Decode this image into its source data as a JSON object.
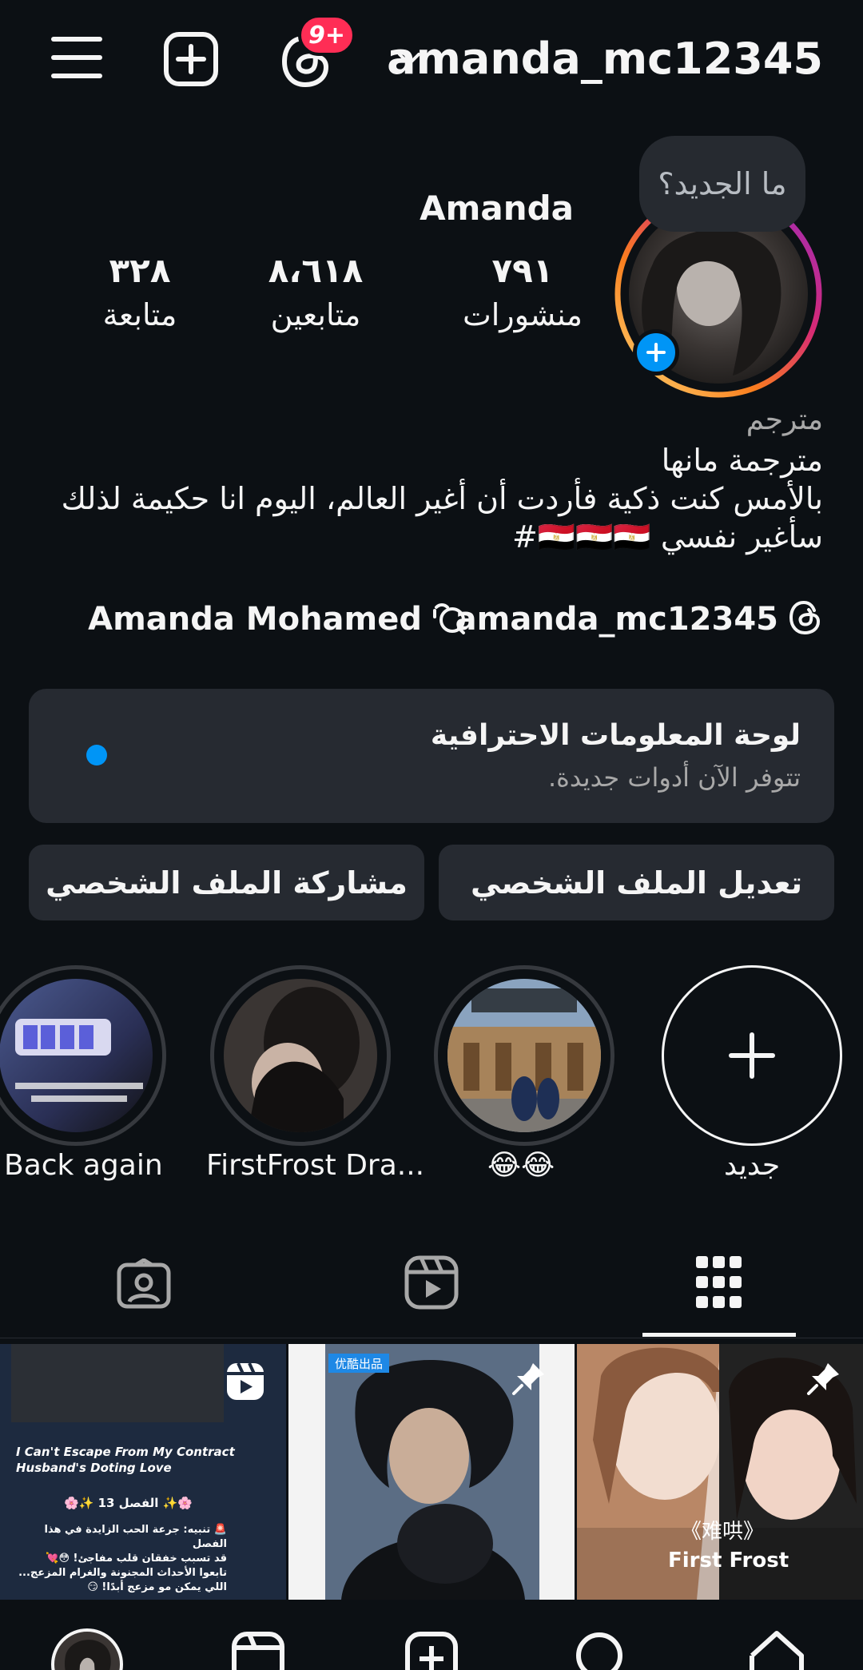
{
  "header": {
    "username": "amanda_mc12345",
    "notifications_badge": "9+",
    "icons": [
      "menu-icon",
      "add-post-icon",
      "threads-icon",
      "chevron-down-icon"
    ]
  },
  "profile": {
    "note_bubble": "ما الجديد؟",
    "display_name": "Amanda",
    "stats": [
      {
        "value": "٧٩١",
        "label": "منشورات"
      },
      {
        "value": "٨،٦١٨",
        "label": "متابعين"
      },
      {
        "value": "٣٢٨",
        "label": "متابعة"
      }
    ],
    "category": "مترجم",
    "bio_lines": [
      "مترجمة مانها",
      "بالأمس كنت ذكية فأردت أن أغير العالم، اليوم انا حكيمة لذلك",
      "سأغير نفسي 🇪🇬🇪🇬🇪🇬#"
    ],
    "threads_link": "amanda_mc12345",
    "linked_name": "Amanda Mohamed"
  },
  "dashboard": {
    "title": "لوحة المعلومات الاحترافية",
    "subtitle": "تتوفر الآن أدوات جديدة."
  },
  "buttons": {
    "edit_profile": "تعديل الملف الشخصي",
    "share_profile": "مشاركة الملف الشخصي"
  },
  "highlights": [
    {
      "label": "Back again"
    },
    {
      "label": "FirstFrost Dra..."
    },
    {
      "label": "😂😂"
    },
    {
      "label": "جديد"
    }
  ],
  "tabs": [
    "grid-tab",
    "reels-tab",
    "tagged-tab"
  ],
  "grid_posts": [
    {
      "title_line1": "I Can't Escape From My Contract",
      "title_line2": "Husband's Doting Love",
      "chapter": "🌸✨ الفصل 13 ✨🌸",
      "line1": "🚨 تنبيه: جرعة الحب الزايدة في هذا الفصل",
      "line2": "قد تسبب خفقان قلب مفاجئ! 😳💘",
      "line3": "تابعوا الأحداث المجنونة والغرام المزعج...",
      "line4": "اللي يمكن مو مزعج أبدًا! 😏"
    },
    {
      "tag": "优酷出品"
    },
    {
      "title_cn": "《难哄》",
      "subtitle": "First Frost"
    }
  ],
  "colors": {
    "background": "#0c1014",
    "card": "#262a31",
    "accent_blue": "#0095f6",
    "badge_red": "#ff2d55"
  }
}
